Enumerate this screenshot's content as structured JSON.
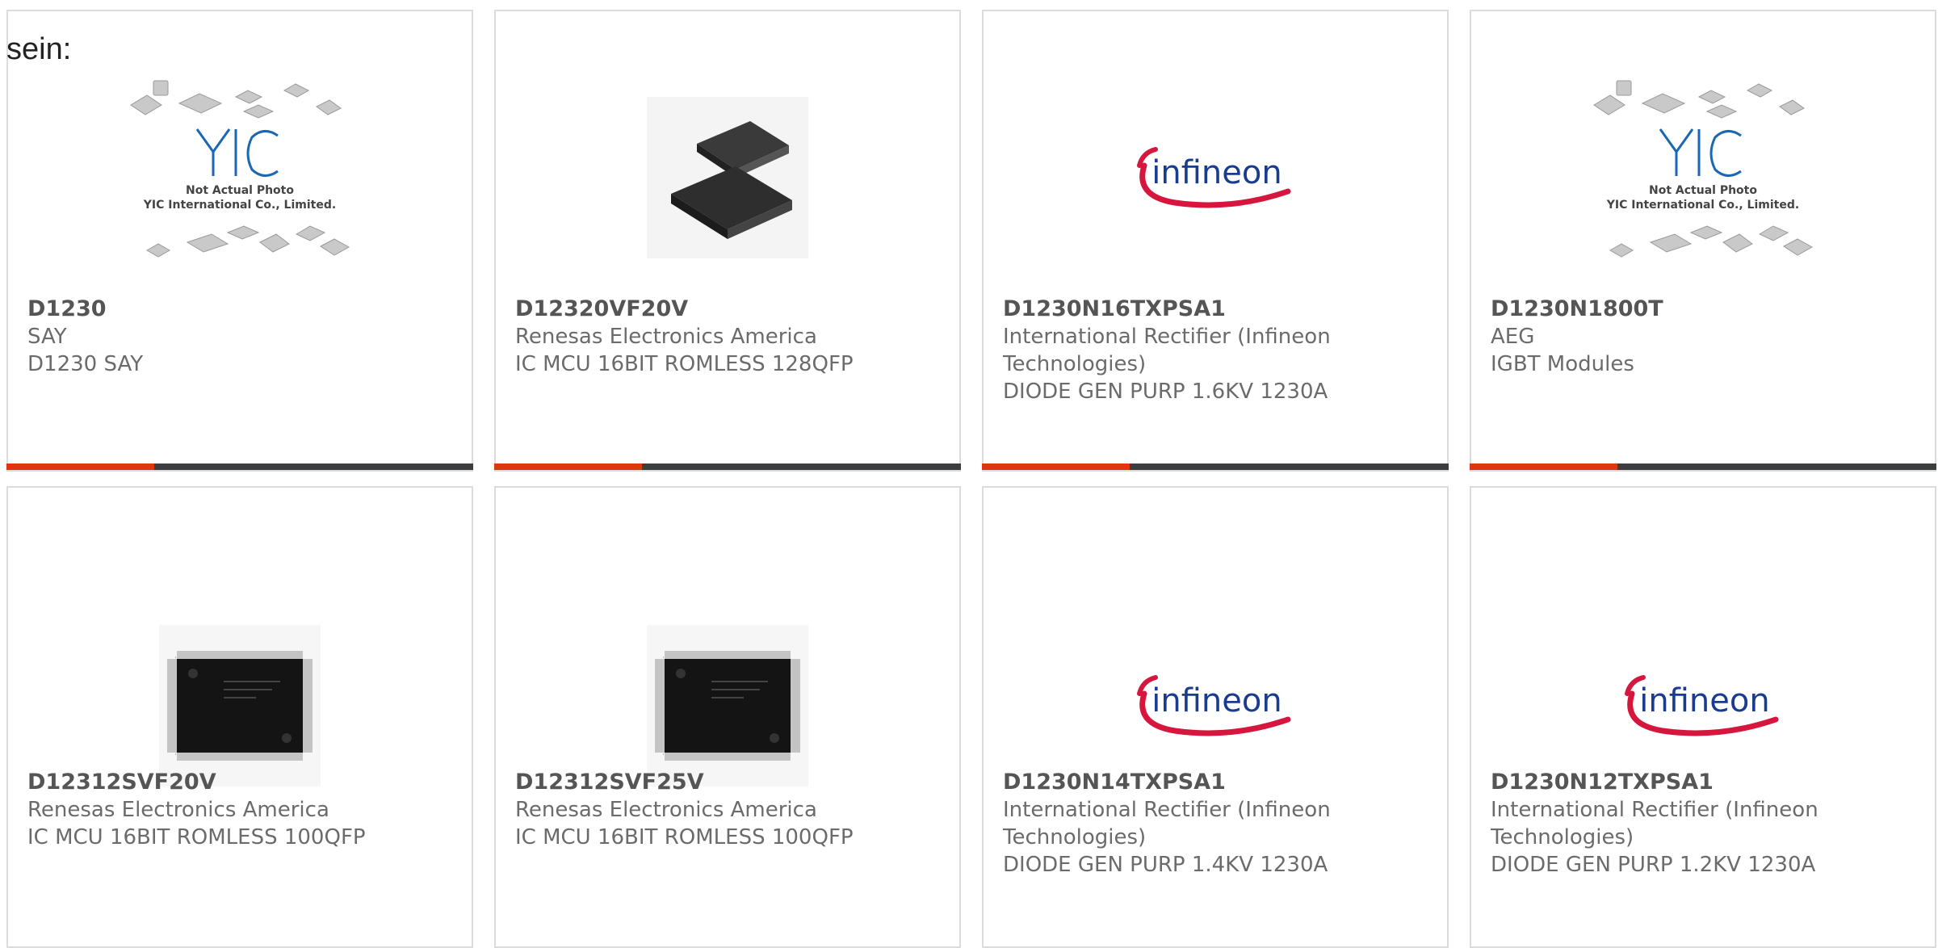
{
  "intro_text": "sein:",
  "brand_colors": {
    "accent": "#e0360d",
    "bar": "#3c3d3f",
    "infineon_blue": "#1a3c8f",
    "infineon_red": "#d6163d"
  },
  "yic_logo": {
    "brand": "YIC",
    "line1": "Not Actual Photo",
    "line2": "YIC International Co., Limited."
  },
  "infineon_logo": {
    "wordmark": "infineon"
  },
  "products": [
    {
      "part": "D1230",
      "maker": "SAY",
      "desc": "D1230 SAY",
      "image": "yic-placeholder-icon"
    },
    {
      "part": "D12320VF20V",
      "maker": "Renesas Electronics America",
      "desc": "IC MCU 16BIT ROMLESS 128QFP",
      "image": "qfp-chip-package-icon"
    },
    {
      "part": "D1230N16TXPSA1",
      "maker": "International Rectifier (Infineon Technologies)",
      "desc": "DIODE GEN PURP 1.6KV 1230A",
      "image": "infineon-logo-icon"
    },
    {
      "part": "D1230N1800T",
      "maker": "AEG",
      "desc": "IGBT Modules",
      "image": "yic-placeholder-icon"
    },
    {
      "part": "D12312SVF20V",
      "maker": "Renesas Electronics America",
      "desc": "IC MCU 16BIT ROMLESS 100QFP",
      "image": "qfp100-chip-icon"
    },
    {
      "part": "D12312SVF25V",
      "maker": "Renesas Electronics America",
      "desc": "IC MCU 16BIT ROMLESS 100QFP",
      "image": "qfp100-chip-icon"
    },
    {
      "part": "D1230N14TXPSA1",
      "maker": "International Rectifier (Infineon Technologies)",
      "desc": "DIODE GEN PURP 1.4KV 1230A",
      "image": "infineon-logo-icon"
    },
    {
      "part": "D1230N12TXPSA1",
      "maker": "International Rectifier (Infineon Technologies)",
      "desc": "DIODE GEN PURP 1.2KV 1230A",
      "image": "infineon-logo-icon"
    }
  ]
}
